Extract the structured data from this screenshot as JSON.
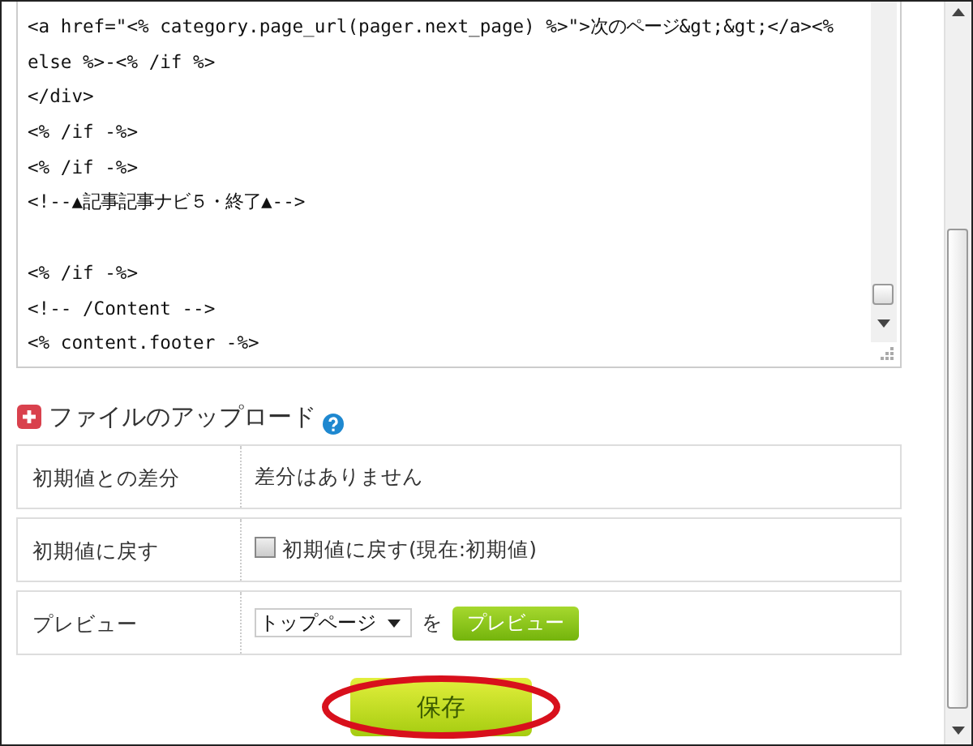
{
  "code_editor": {
    "blocks": [
      [
        "<a href=\"<% category.page_url(pager.next_page) %>\">次のページ&gt;&gt;</a><%",
        "else %>-<% /if %>",
        "</div>",
        "<% /if -%>",
        "<% /if -%>",
        "<!--▲記事記事ナビ５・終了▲-->"
      ],
      [
        "<% /if -%>",
        "<!-- /Content -->",
        "<% content.footer -%>"
      ]
    ]
  },
  "upload": {
    "title": "ファイルのアップロード",
    "expanded": false
  },
  "rows": [
    {
      "kind": "text",
      "label": "初期値との差分",
      "value": "差分はありません"
    },
    {
      "kind": "checkbox",
      "label": "初期値に戻す",
      "checkbox_label": "初期値に戻す(現在:初期値)",
      "checked": false
    },
    {
      "kind": "preview",
      "label": "プレビュー",
      "select_value": "トップページ",
      "connector": "を",
      "button": "プレビュー"
    }
  ],
  "save_button": {
    "label": "保存",
    "circled": true
  }
}
